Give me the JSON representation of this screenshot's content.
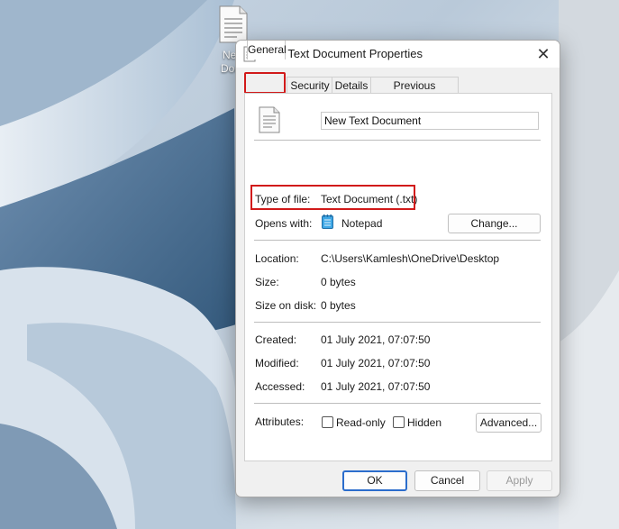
{
  "desktop": {
    "icon_label": "New Text Document",
    "icon_label_visible_line1": "New",
    "icon_label_visible_line2": "Docu"
  },
  "dialog": {
    "title": "New Text Document Properties",
    "close_glyph": "✕",
    "tabs": [
      {
        "label": "General",
        "active": true
      },
      {
        "label": "Security",
        "active": false
      },
      {
        "label": "Details",
        "active": false
      },
      {
        "label": "Previous Versions",
        "active": false
      }
    ],
    "file_name": "New Text Document",
    "type_of_file": {
      "label": "Type of file:",
      "value": "Text Document (.txt)"
    },
    "opens_with": {
      "label": "Opens with:",
      "value": "Notepad",
      "button": "Change..."
    },
    "location": {
      "label": "Location:",
      "value": "C:\\Users\\Kamlesh\\OneDrive\\Desktop"
    },
    "size": {
      "label": "Size:",
      "value": "0 bytes"
    },
    "size_on_disk": {
      "label": "Size on disk:",
      "value": "0 bytes"
    },
    "created": {
      "label": "Created:",
      "value": "01 July 2021, 07:07:50"
    },
    "modified": {
      "label": "Modified:",
      "value": "01 July 2021, 07:07:50"
    },
    "accessed": {
      "label": "Accessed:",
      "value": "01 July 2021, 07:07:50"
    },
    "attributes": {
      "label": "Attributes:",
      "readonly_label": "Read-only",
      "readonly_checked": false,
      "hidden_label": "Hidden",
      "hidden_checked": false,
      "advanced_button": "Advanced..."
    },
    "buttons": {
      "ok": "OK",
      "cancel": "Cancel",
      "apply": "Apply"
    }
  },
  "colors": {
    "highlight": "#d11a1a",
    "accent": "#2b6dcc"
  },
  "icons": [
    "text-file-icon",
    "close-icon",
    "notepad-icon"
  ]
}
